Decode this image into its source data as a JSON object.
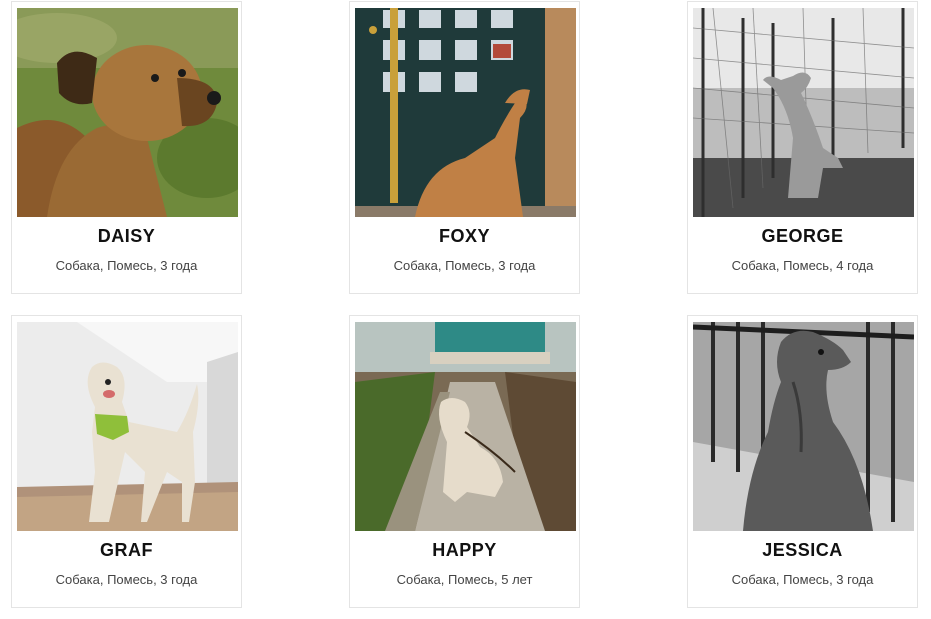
{
  "pets": [
    {
      "name": "DAISY",
      "info": "Собака, Помесь, 3 года"
    },
    {
      "name": "FOXY",
      "info": "Собака, Помесь, 3 года"
    },
    {
      "name": "GEORGE",
      "info": "Собака, Помесь, 4 года"
    },
    {
      "name": "GRAF",
      "info": "Собака, Помесь, 3 года"
    },
    {
      "name": "HAPPY",
      "info": "Собака, Помесь, 5 лет"
    },
    {
      "name": "JESSICA",
      "info": "Собака, Помесь, 3 года"
    }
  ]
}
